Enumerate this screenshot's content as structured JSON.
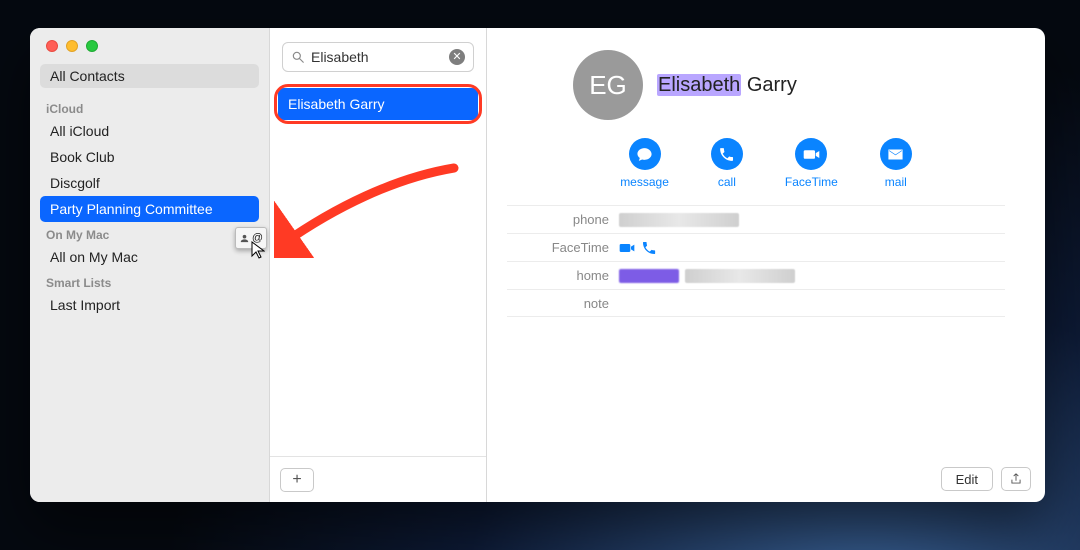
{
  "sidebar": {
    "all_contacts": "All Contacts",
    "sections": [
      {
        "header": "iCloud",
        "items": [
          "All iCloud",
          "Book Club",
          "Discgolf",
          "Party Planning Committee"
        ],
        "selected_index": 3
      },
      {
        "header": "On My Mac",
        "items": [
          "All on My Mac"
        ],
        "selected_index": -1
      },
      {
        "header": "Smart Lists",
        "items": [
          "Last Import"
        ],
        "selected_index": -1
      }
    ]
  },
  "search": {
    "query": "Elisabeth"
  },
  "results": {
    "items": [
      "Elisabeth Garry"
    ],
    "selected_index": 0
  },
  "contact": {
    "initials": "EG",
    "first_name": "Elisabeth",
    "last_name": "Garry",
    "actions": {
      "message": "message",
      "call": "call",
      "facetime": "FaceTime",
      "mail": "mail"
    },
    "fields": {
      "phone_label": "phone",
      "facetime_label": "FaceTime",
      "home_label": "home",
      "note_label": "note"
    }
  },
  "buttons": {
    "plus": "+",
    "edit": "Edit"
  },
  "drag_glyph": "@"
}
